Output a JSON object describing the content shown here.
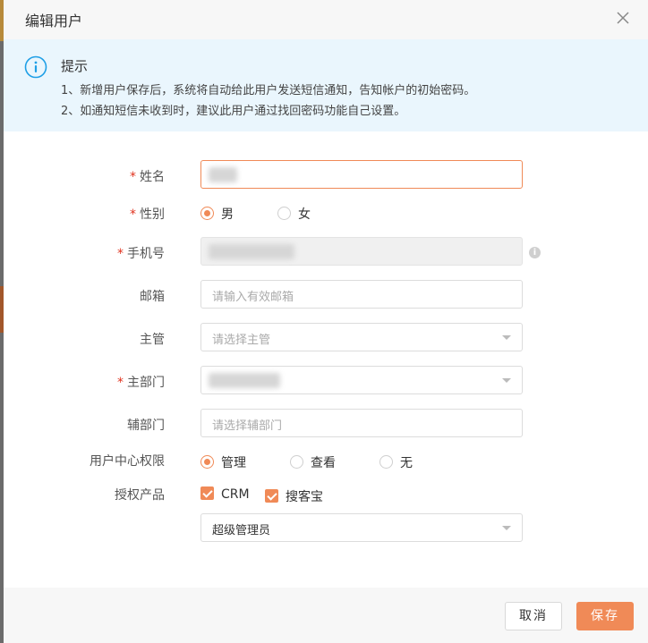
{
  "dialog": {
    "title": "编辑用户"
  },
  "tip": {
    "title": "提示",
    "line1": "1、新增用户保存后，系统将自动给此用户发送短信通知，告知帐户的初始密码。",
    "line2": "2、如通知短信未收到时，建议此用户通过找回密码功能自己设置。"
  },
  "form": {
    "required_mark": "*",
    "name": {
      "label": "姓名"
    },
    "gender": {
      "label": "性别",
      "options": [
        "男",
        "女"
      ],
      "selected": "男"
    },
    "phone": {
      "label": "手机号"
    },
    "email": {
      "label": "邮箱",
      "placeholder": "请输入有效邮箱"
    },
    "supervisor": {
      "label": "主管",
      "placeholder": "请选择主管"
    },
    "main_dept": {
      "label": "主部门"
    },
    "sub_dept": {
      "label": "辅部门",
      "placeholder": "请选择辅部门"
    },
    "user_center": {
      "label": "用户中心权限",
      "options": [
        "管理",
        "查看",
        "无"
      ],
      "selected": "管理"
    },
    "products": {
      "label": "授权产品",
      "options": [
        "CRM",
        "搜客宝"
      ],
      "checked": [
        "CRM",
        "搜客宝"
      ]
    },
    "role": {
      "value": "超级管理员"
    }
  },
  "footer": {
    "cancel_label": "取消",
    "save_label": "保存"
  },
  "colors": {
    "accent": "#f08a57",
    "tip_bg": "#eaf6fd",
    "required": "#e0321e",
    "info_blue": "#1e9fe6"
  },
  "icons": {
    "close": "close-icon",
    "info": "info-circle-icon",
    "hint": "info-small-icon",
    "dropdown": "chevron-down-icon"
  }
}
